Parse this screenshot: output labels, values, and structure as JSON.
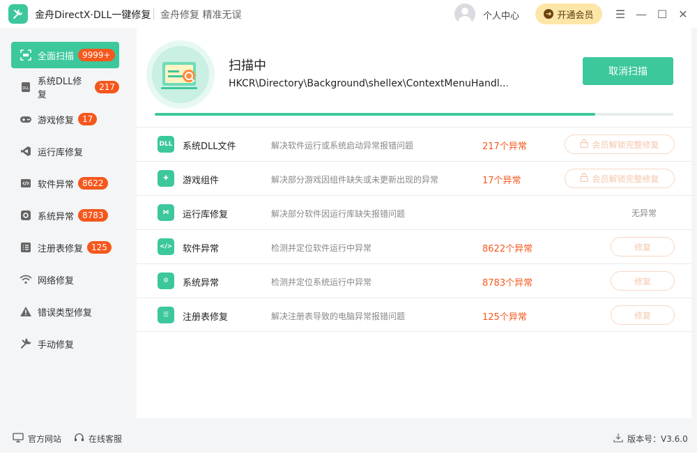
{
  "titlebar": {
    "app_title": "金舟DirectX·DLL一键修复",
    "slogan": "金舟修复 精准无误",
    "user_center": "个人中心",
    "vip_label": "开通会员",
    "vip_icon": "arrow-right-icon",
    "controls": {
      "menu": "☰",
      "minimize": "—",
      "maximize": "☐",
      "close": "✕"
    }
  },
  "sidebar": {
    "items": [
      {
        "label": "全面扫描",
        "badge": "9999+",
        "icon": "scan-icon"
      },
      {
        "label": "系统DLL修复",
        "badge": "217",
        "icon": "dll-icon"
      },
      {
        "label": "游戏修复",
        "badge": "17",
        "icon": "gamepad-icon"
      },
      {
        "label": "运行库修复",
        "badge": "",
        "icon": "vs-runtime-icon"
      },
      {
        "label": "软件异常",
        "badge": "8622",
        "icon": "code-icon"
      },
      {
        "label": "系统异常",
        "badge": "8783",
        "icon": "gear-icon"
      },
      {
        "label": "注册表修复",
        "badge": "125",
        "icon": "list-icon"
      },
      {
        "label": "网络修复",
        "badge": "",
        "icon": "wifi-icon"
      },
      {
        "label": "错误类型修复",
        "badge": "",
        "icon": "warning-icon"
      },
      {
        "label": "手动修复",
        "badge": "",
        "icon": "tools-icon"
      }
    ]
  },
  "scan": {
    "title": "扫描中",
    "path": "HKCR\\Directory\\Background\\shellex\\ContextMenuHandl...",
    "cancel_label": "取消扫描",
    "progress": 0.85
  },
  "rows": [
    {
      "name": "系统DLL文件",
      "desc": "解决软件运行或系统启动异常报错问题",
      "count": "217个异常",
      "action": "会员解锁完整修复",
      "action_type": "unlock",
      "icon": "dll-icon",
      "icon_text": "DLL"
    },
    {
      "name": "游戏组件",
      "desc": "解决部分游戏因组件缺失或未更新出现的异常",
      "count": "17个异常",
      "action": "会员解锁完整修复",
      "action_type": "unlock",
      "icon": "gamepad-icon",
      "icon_text": "✚"
    },
    {
      "name": "运行库修复",
      "desc": "解决部分软件因运行库缺失报错问题",
      "count": "无异常",
      "action": "",
      "action_type": "none",
      "icon": "vs-runtime-icon",
      "icon_text": "⋈"
    },
    {
      "name": "软件异常",
      "desc": "检测并定位软件运行中异常",
      "count": "8622个异常",
      "action": "修复",
      "action_type": "repair",
      "icon": "code-icon",
      "icon_text": "</>"
    },
    {
      "name": "系统异常",
      "desc": "检测并定位系统运行中异常",
      "count": "8783个异常",
      "action": "修复",
      "action_type": "repair",
      "icon": "gear-icon",
      "icon_text": "⚙"
    },
    {
      "name": "注册表修复",
      "desc": "解决注册表导致的电脑异常报错问题",
      "count": "125个异常",
      "action": "修复",
      "action_type": "repair",
      "icon": "list-icon",
      "icon_text": "☰"
    }
  ],
  "footer": {
    "website": "官方网站",
    "support": "在线客服",
    "version": "版本号：V3.6.0"
  },
  "colors": {
    "accent": "#3cc79c",
    "warn": "#f5571c",
    "vip": "#fde7a8"
  }
}
